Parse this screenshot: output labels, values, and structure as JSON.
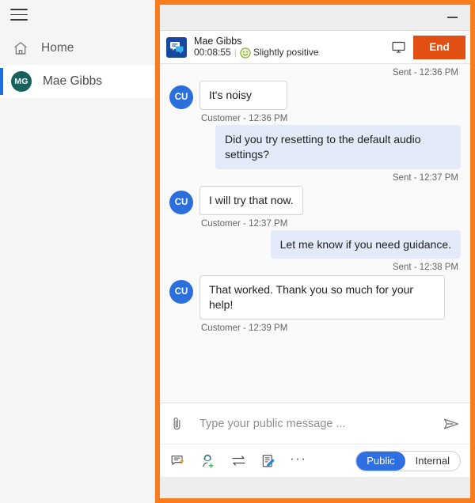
{
  "sidebar": {
    "menu_icon": "hamburger-menu-icon",
    "items": [
      {
        "label": "Home",
        "icon": "home-icon",
        "selected": false
      },
      {
        "label": "Mae Gibbs",
        "icon": "avatar-initials",
        "initials": "MG",
        "selected": true
      }
    ]
  },
  "window": {
    "minimize_label": "minimize-icon"
  },
  "conversation": {
    "app_icon": "chat-bubbles-icon",
    "customer_name": "Mae Gibbs",
    "duration": "00:08:55",
    "separator": "|",
    "sentiment_emoji": "🙂",
    "sentiment_label": "Slightly positive",
    "monitor_icon": "monitor-icon",
    "end_label": "End",
    "end_color": "#e14f13"
  },
  "messages": [
    {
      "type": "stamp",
      "text": "Sent - 12:36 PM"
    },
    {
      "type": "inbound",
      "avatar": "CU",
      "text": "It's noisy",
      "stamp": "Customer - 12:36 PM"
    },
    {
      "type": "outbound",
      "text": "Did you try resetting to the default audio settings?",
      "stamp": "Sent - 12:37 PM"
    },
    {
      "type": "inbound",
      "avatar": "CU",
      "text": "I will try that now.",
      "stamp": "Customer - 12:37 PM"
    },
    {
      "type": "outbound",
      "text": "Let me know if you need guidance.",
      "stamp": "Sent - 12:38 PM"
    },
    {
      "type": "inbound",
      "avatar": "CU",
      "text": "That worked. Thank you so much for your help!",
      "stamp": "Customer - 12:39 PM"
    }
  ],
  "msg_items": {
    "stamp0": "Sent - 12:36 PM",
    "m1_text": "It's noisy",
    "m1_avatar": "CU",
    "m1_stamp": "Customer - 12:36 PM",
    "m2_text": "Did you try resetting to the default audio settings?",
    "m2_stamp": "Sent - 12:37 PM",
    "m3_text": "I will try that now.",
    "m3_avatar": "CU",
    "m3_stamp": "Customer - 12:37 PM",
    "m4_text": "Let me know if you need guidance.",
    "m4_stamp": "Sent - 12:38 PM",
    "m5_text": "That worked. Thank you so much for your help!",
    "m5_avatar": "CU",
    "m5_stamp": "Customer - 12:39 PM"
  },
  "composer": {
    "attach_icon": "paperclip-icon",
    "placeholder": "Type your public message ...",
    "value": "",
    "send_icon": "send-icon",
    "tools": [
      {
        "name": "quick-reply-icon"
      },
      {
        "name": "add-agent-icon"
      },
      {
        "name": "transfer-icon"
      },
      {
        "name": "notes-icon"
      }
    ],
    "more_label": "···",
    "visibility": {
      "options": [
        "Public",
        "Internal"
      ],
      "selected": "Public",
      "active_color": "#2f6fe4"
    }
  }
}
